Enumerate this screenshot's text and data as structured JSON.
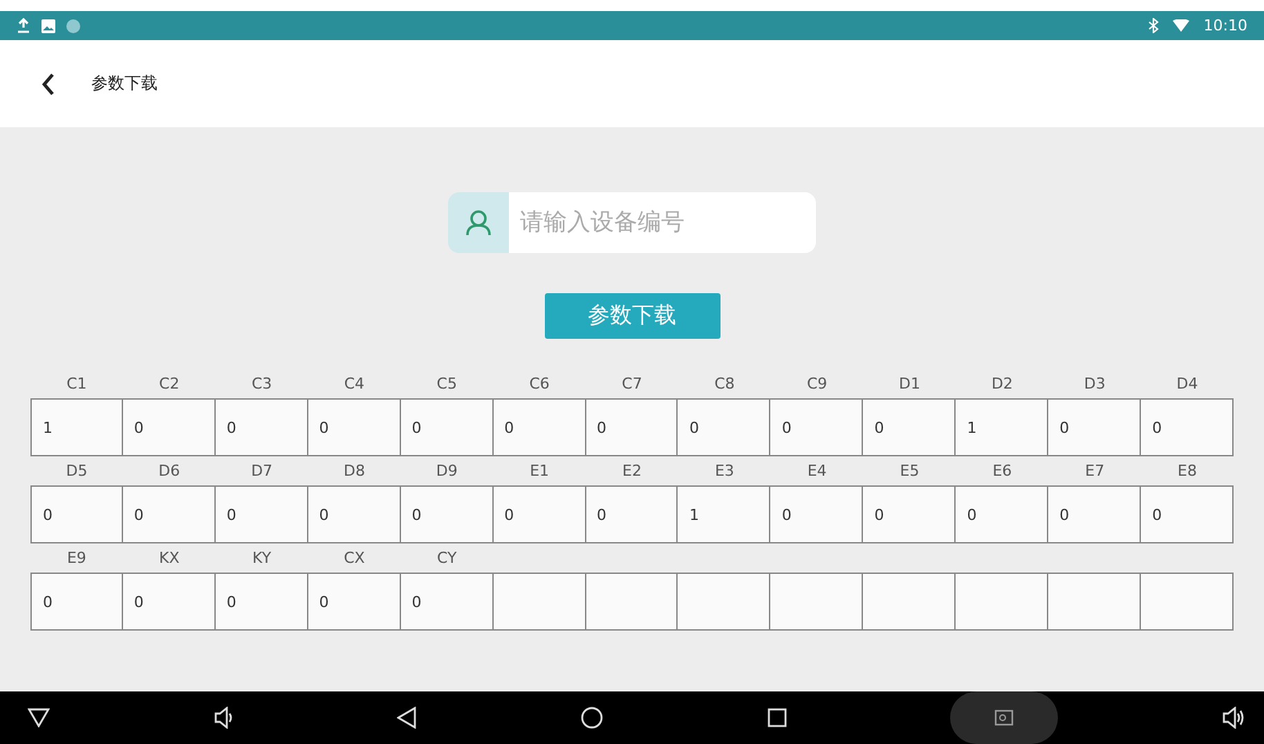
{
  "status_bar": {
    "time": "10:10"
  },
  "header": {
    "title": "参数下载"
  },
  "device_field": {
    "placeholder": "请输入设备编号"
  },
  "download_button": "参数下载",
  "params": [
    {
      "label": "C1",
      "value": "1"
    },
    {
      "label": "C2",
      "value": "0"
    },
    {
      "label": "C3",
      "value": "0"
    },
    {
      "label": "C4",
      "value": "0"
    },
    {
      "label": "C5",
      "value": "0"
    },
    {
      "label": "C6",
      "value": "0"
    },
    {
      "label": "C7",
      "value": "0"
    },
    {
      "label": "C8",
      "value": "0"
    },
    {
      "label": "C9",
      "value": "0"
    },
    {
      "label": "D1",
      "value": "0"
    },
    {
      "label": "D2",
      "value": "1"
    },
    {
      "label": "D3",
      "value": "0"
    },
    {
      "label": "D4",
      "value": "0"
    },
    {
      "label": "D5",
      "value": "0"
    },
    {
      "label": "D6",
      "value": "0"
    },
    {
      "label": "D7",
      "value": "0"
    },
    {
      "label": "D8",
      "value": "0"
    },
    {
      "label": "D9",
      "value": "0"
    },
    {
      "label": "E1",
      "value": "0"
    },
    {
      "label": "E2",
      "value": "0"
    },
    {
      "label": "E3",
      "value": "1"
    },
    {
      "label": "E4",
      "value": "0"
    },
    {
      "label": "E5",
      "value": "0"
    },
    {
      "label": "E6",
      "value": "0"
    },
    {
      "label": "E7",
      "value": "0"
    },
    {
      "label": "E8",
      "value": "0"
    },
    {
      "label": "E9",
      "value": "0"
    },
    {
      "label": "KX",
      "value": "0"
    },
    {
      "label": "KY",
      "value": "0"
    },
    {
      "label": "CX",
      "value": "0"
    },
    {
      "label": "CY",
      "value": "0"
    }
  ]
}
